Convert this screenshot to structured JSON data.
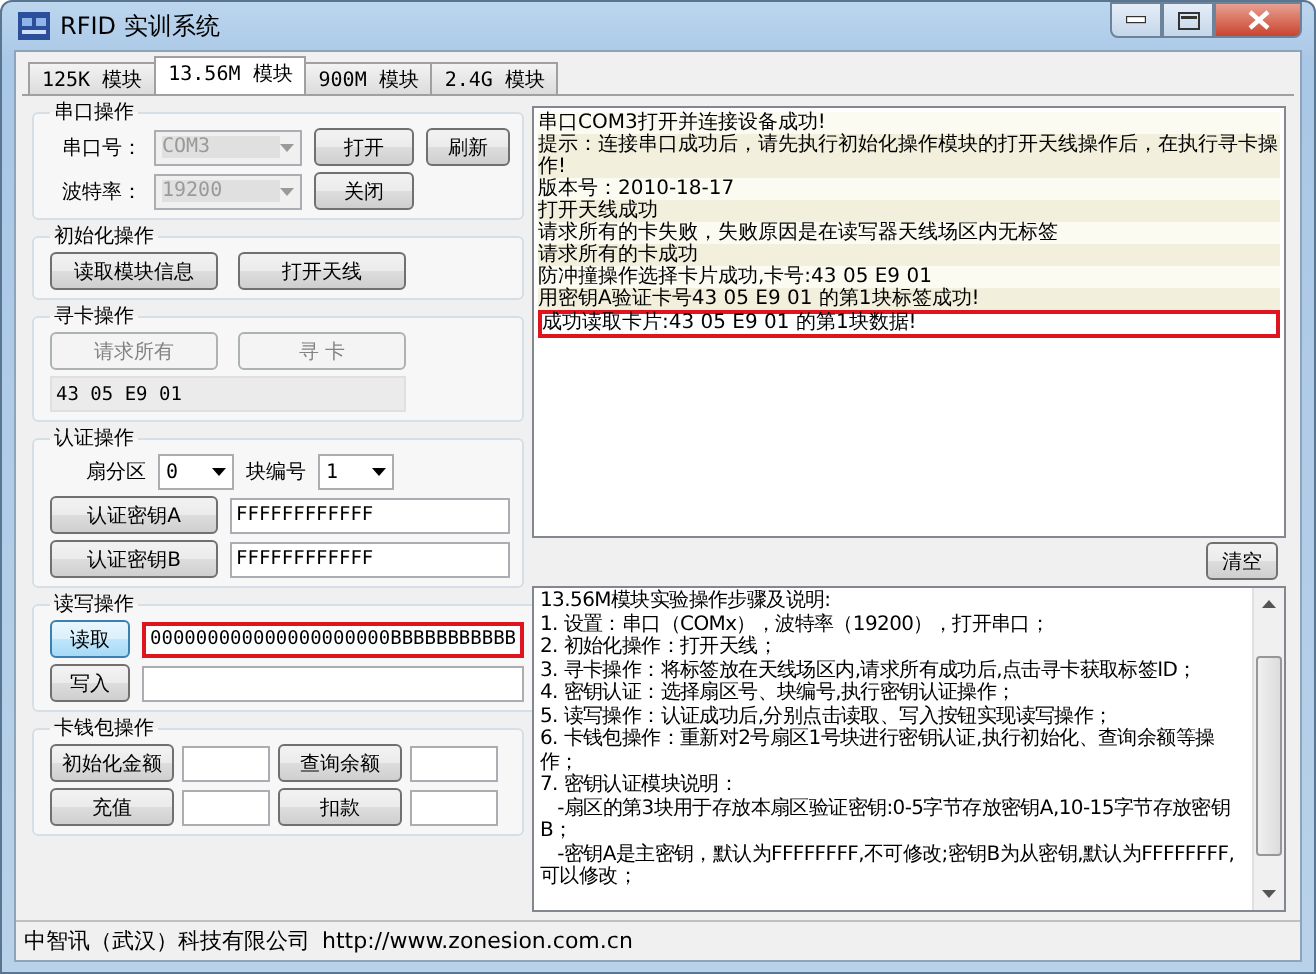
{
  "window": {
    "title": "RFID 实训系统"
  },
  "tabs": [
    {
      "label": "125K 模块",
      "selected": false
    },
    {
      "label": "13.56M 模块",
      "selected": true
    },
    {
      "label": "900M 模块",
      "selected": false
    },
    {
      "label": "2.4G 模块",
      "selected": false
    }
  ],
  "serial": {
    "title": "串口操作",
    "port_label": "串口号：",
    "port": {
      "value": "COM3",
      "disabled": true
    },
    "baud_label": "波特率：",
    "baud": {
      "value": "19200",
      "disabled": true
    },
    "buttons": [
      {
        "label": "打开",
        "disabled": false
      },
      {
        "label": "刷新",
        "disabled": false
      },
      {
        "label": "关闭",
        "disabled": false
      }
    ]
  },
  "init": {
    "title": "初始化操作",
    "buttons": [
      {
        "label": "读取模块信息",
        "disabled": false
      },
      {
        "label": "打开天线",
        "disabled": false
      }
    ]
  },
  "search": {
    "title": "寻卡操作",
    "buttons": [
      {
        "label": "请求所有",
        "disabled": true
      },
      {
        "label": "寻 卡",
        "disabled": true
      }
    ],
    "card_id": "43 05 E9 01"
  },
  "auth": {
    "title": "认证操作",
    "sector_label": "扇分区",
    "sector": "0",
    "block_label": "块编号",
    "block": "1",
    "keys": [
      {
        "button": "认证密钥A",
        "value": "FFFFFFFFFFFF"
      },
      {
        "button": "认证密钥B",
        "value": "FFFFFFFFFFFF"
      }
    ]
  },
  "readwrite": {
    "title": "读写操作",
    "rows": [
      {
        "button": "读取",
        "focused": true,
        "value": "000000000000000000000BBBBBBBBBBB",
        "highlighted": true
      },
      {
        "button": "写入",
        "focused": false,
        "highlighted": false
      }
    ]
  },
  "wallet": {
    "title": "卡钱包操作",
    "buttons": [
      {
        "label": "初始化金额"
      },
      {
        "label": "查询余额"
      },
      {
        "label": "充值"
      },
      {
        "label": "扣款"
      }
    ]
  },
  "log": {
    "lines": [
      {
        "text": "串口COM3打开并连接设备成功!",
        "highlighted": false
      },
      {
        "text": "提示：连接串口成功后，请先执行初始化操作模块的打开天线操作后，在执行寻卡操作!",
        "highlighted": false
      },
      {
        "text": "版本号：2010-18-17",
        "highlighted": false
      },
      {
        "text": "打开天线成功",
        "highlighted": false
      },
      {
        "text": "请求所有的卡失败，失败原因是在读写器天线场区内无标签",
        "highlighted": false
      },
      {
        "text": "请求所有的卡成功",
        "highlighted": false
      },
      {
        "text": "防冲撞操作选择卡片成功,卡号:43  05  E9  01",
        "highlighted": false
      },
      {
        "text": "用密钥A验证卡号43  05  E9  01 的第1块标签成功!",
        "highlighted": false
      },
      {
        "text": "成功读取卡片:43  05  E9  01  的第1块数据!",
        "highlighted": true
      }
    ],
    "clear_button": "清空"
  },
  "instructions": {
    "lines": [
      "13.56M模块实验操作步骤及说明:",
      "1. 设置：串口（COMx），波特率（19200），打开串口；",
      "2. 初始化操作：打开天线；",
      "3. 寻卡操作：将标签放在天线场区内,请求所有成功后,点击寻卡获取标签ID；",
      "4. 密钥认证：选择扇区号、块编号,执行密钥认证操作；",
      "5. 读写操作：认证成功后,分别点击读取、写入按钮实现读写操作；",
      "6. 卡钱包操作：重新对2号扇区1号块进行密钥认证,执行初始化、查询余额等操作；",
      "7. 密钥认证模块说明：",
      "   -扇区的第3块用于存放本扇区验证密钥:0-5字节存放密钥A,10-15字节存放密钥B；",
      "   -密钥A是主密钥，默认为FFFFFFFF,不可修改;密钥B为从密钥,默认为FFFFFFFF,可以修改；"
    ]
  },
  "status_bar": {
    "company": "中智讯（武汉）科技有限公司",
    "url": "http://www.zonesion.com.cn"
  }
}
